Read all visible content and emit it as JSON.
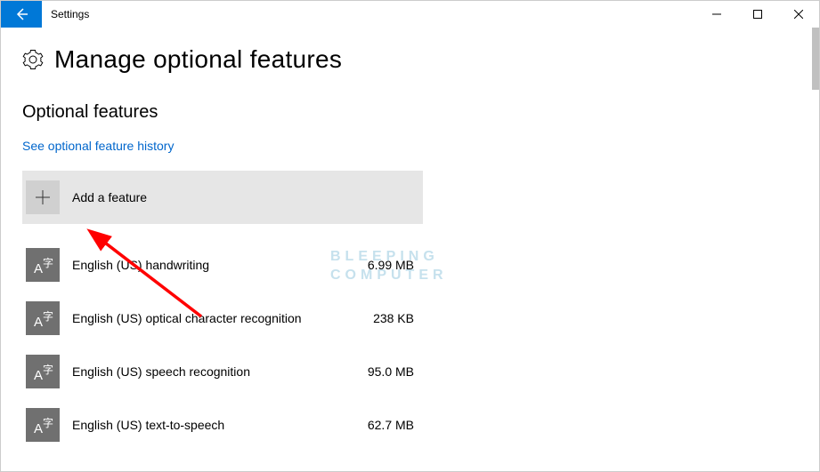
{
  "window": {
    "title": "Settings"
  },
  "page": {
    "header": "Manage optional features",
    "section": "Optional features",
    "link": "See optional feature history",
    "add_label": "Add a feature"
  },
  "features": [
    {
      "name": "English (US) handwriting",
      "size": "6.99 MB"
    },
    {
      "name": "English (US) optical character recognition",
      "size": "238 KB"
    },
    {
      "name": "English (US) speech recognition",
      "size": "95.0 MB"
    },
    {
      "name": "English (US) text-to-speech",
      "size": "62.7 MB"
    }
  ],
  "watermark": {
    "line1": "BLEEPING",
    "line2": "COMPUTER"
  }
}
